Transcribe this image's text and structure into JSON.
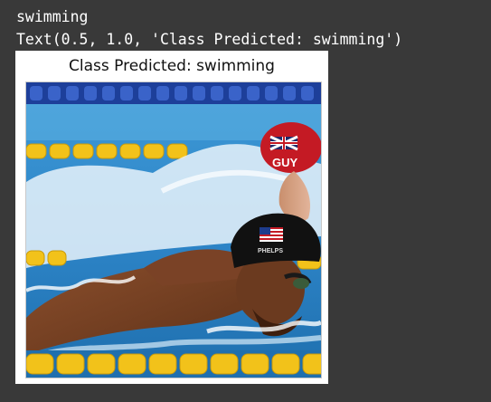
{
  "output": {
    "stdout_lines": [
      "swimming",
      "Text(0.5, 1.0, 'Class Predicted: swimming')"
    ]
  },
  "figure": {
    "title": "Class Predicted: swimming",
    "image_subject": "butterfly swimmers in pool",
    "cap_front_text": "PHELPS",
    "cap_back_text": "GUY",
    "colors": {
      "background": "#393939",
      "water": "#2e86c9",
      "lane_rope": "#f2c21a",
      "cap_front": "#111111",
      "cap_back": "#c41a24"
    }
  }
}
